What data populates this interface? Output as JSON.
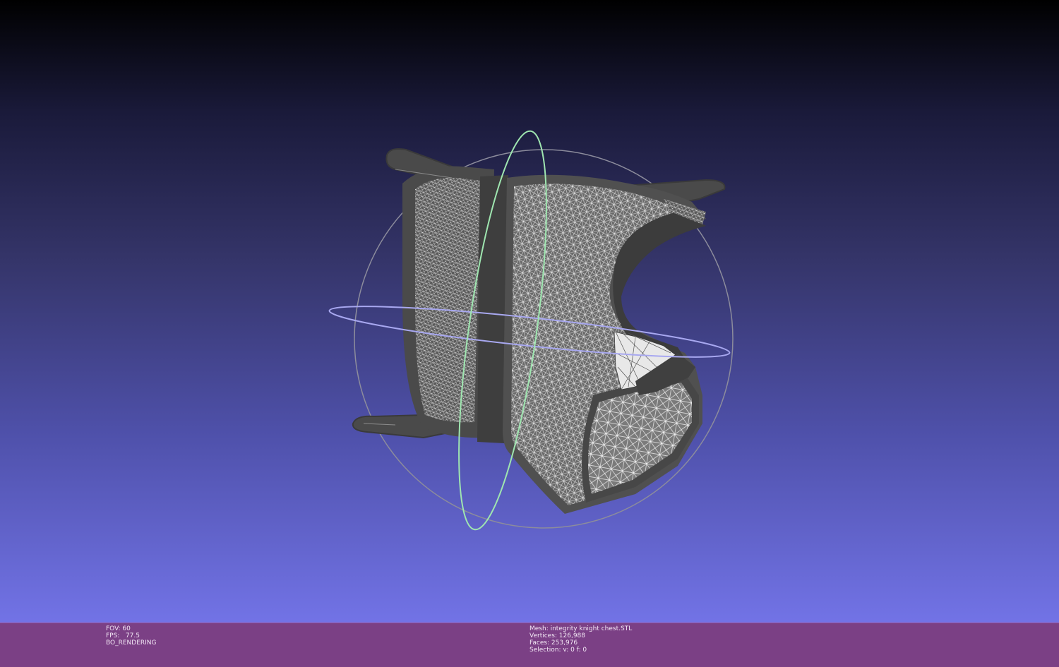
{
  "viewport": {
    "background_top": "#000000",
    "background_bottom": "#7273e6",
    "mesh_color": "#4a4a4a",
    "wire_color": "#d8d8d8",
    "trackball_colors": {
      "horizontal": "#a8a8f0",
      "vertical": "#9fe6b0",
      "outer": "#8c8c9c"
    }
  },
  "status": {
    "fov": "FOV: 60",
    "fps": "FPS:   77.5",
    "mode": "BO_RENDERING",
    "mesh": "Mesh: integrity knight chest.STL",
    "vertices": "Vertices: 126,988",
    "faces": "Faces: 253,976",
    "selection": "Selection: v: 0 f: 0"
  }
}
